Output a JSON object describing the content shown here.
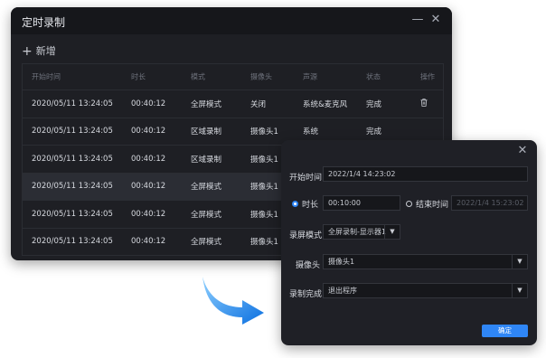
{
  "main_window": {
    "title": "定时录制",
    "add_label": "新增",
    "columns": [
      "开始时间",
      "时长",
      "模式",
      "摄像头",
      "声源",
      "状态",
      "操作"
    ],
    "rows": [
      {
        "start": "2020/05/11  13:24:05",
        "duration": "00:40:12",
        "mode": "全屏模式",
        "camera": "关闭",
        "audio": "系统&麦克风",
        "status": "完成"
      },
      {
        "start": "2020/05/11  13:24:05",
        "duration": "00:40:12",
        "mode": "区域录制",
        "camera": "摄像头1",
        "audio": "系统",
        "status": "完成"
      },
      {
        "start": "2020/05/11  13:24:05",
        "duration": "00:40:12",
        "mode": "区域录制",
        "camera": "摄像头1",
        "audio": "",
        "status": ""
      },
      {
        "start": "2020/05/11  13:24:05",
        "duration": "00:40:12",
        "mode": "全屏模式",
        "camera": "摄像头1",
        "audio": "",
        "status": ""
      },
      {
        "start": "2020/05/11  13:24:05",
        "duration": "00:40:12",
        "mode": "全屏模式",
        "camera": "摄像头1",
        "audio": "",
        "status": ""
      },
      {
        "start": "2020/05/11  13:24:05",
        "duration": "00:40:12",
        "mode": "全屏模式",
        "camera": "摄像头1",
        "audio": "",
        "status": ""
      }
    ],
    "selected_row": 3,
    "icons": {
      "minimize": "minimize-icon",
      "close": "close-icon",
      "delete": "trash-icon",
      "add": "plus-icon"
    }
  },
  "dialog": {
    "start_time_label": "开始时间",
    "start_time_value": "2022/1/4  14:23:02",
    "duration_label": "时长",
    "duration_value": "00:10:00",
    "end_time_label": "结束时间",
    "end_time_value": "2022/1/4  15:23:02",
    "duration_selected": true,
    "mode_label": "录屏模式",
    "mode_value": "全屏录制-显示器1",
    "camera_label": "摄像头",
    "camera_value": "摄像头1",
    "after_label": "录制完成",
    "after_value": "退出程序",
    "confirm_label": "确定"
  },
  "colors": {
    "accent": "#2f86f6",
    "window_bg": "#1e1f24",
    "arrow": "#1f8ef0"
  }
}
